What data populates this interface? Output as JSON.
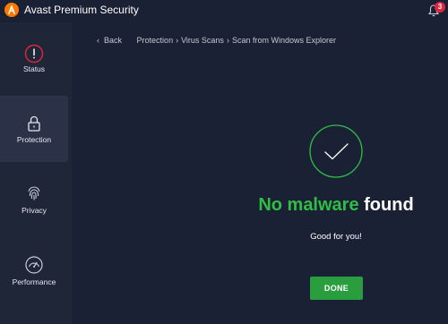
{
  "app": {
    "title": "Avast Premium Security",
    "notification_count": "3"
  },
  "sidebar": {
    "items": [
      {
        "label": "Status",
        "icon": "alert-circle-icon",
        "active": false
      },
      {
        "label": "Protection",
        "icon": "lock-icon",
        "active": true
      },
      {
        "label": "Privacy",
        "icon": "fingerprint-icon",
        "active": false
      },
      {
        "label": "Performance",
        "icon": "speedometer-icon",
        "active": false
      }
    ]
  },
  "breadcrumb": {
    "back_label": "Back",
    "items": [
      "Protection",
      "Virus Scans",
      "Scan from Windows Explorer"
    ],
    "separator": "›"
  },
  "result": {
    "headline_highlight": "No malware",
    "headline_rest": "found",
    "subtitle": "Good for you!",
    "done_label": "DONE"
  },
  "colors": {
    "background": "#1b2134",
    "sidebar": "#1f2638",
    "accent_green": "#2fbd45",
    "button_green": "#2a9d3e",
    "brand_orange": "#ff7800",
    "status_red": "#e0253c"
  }
}
